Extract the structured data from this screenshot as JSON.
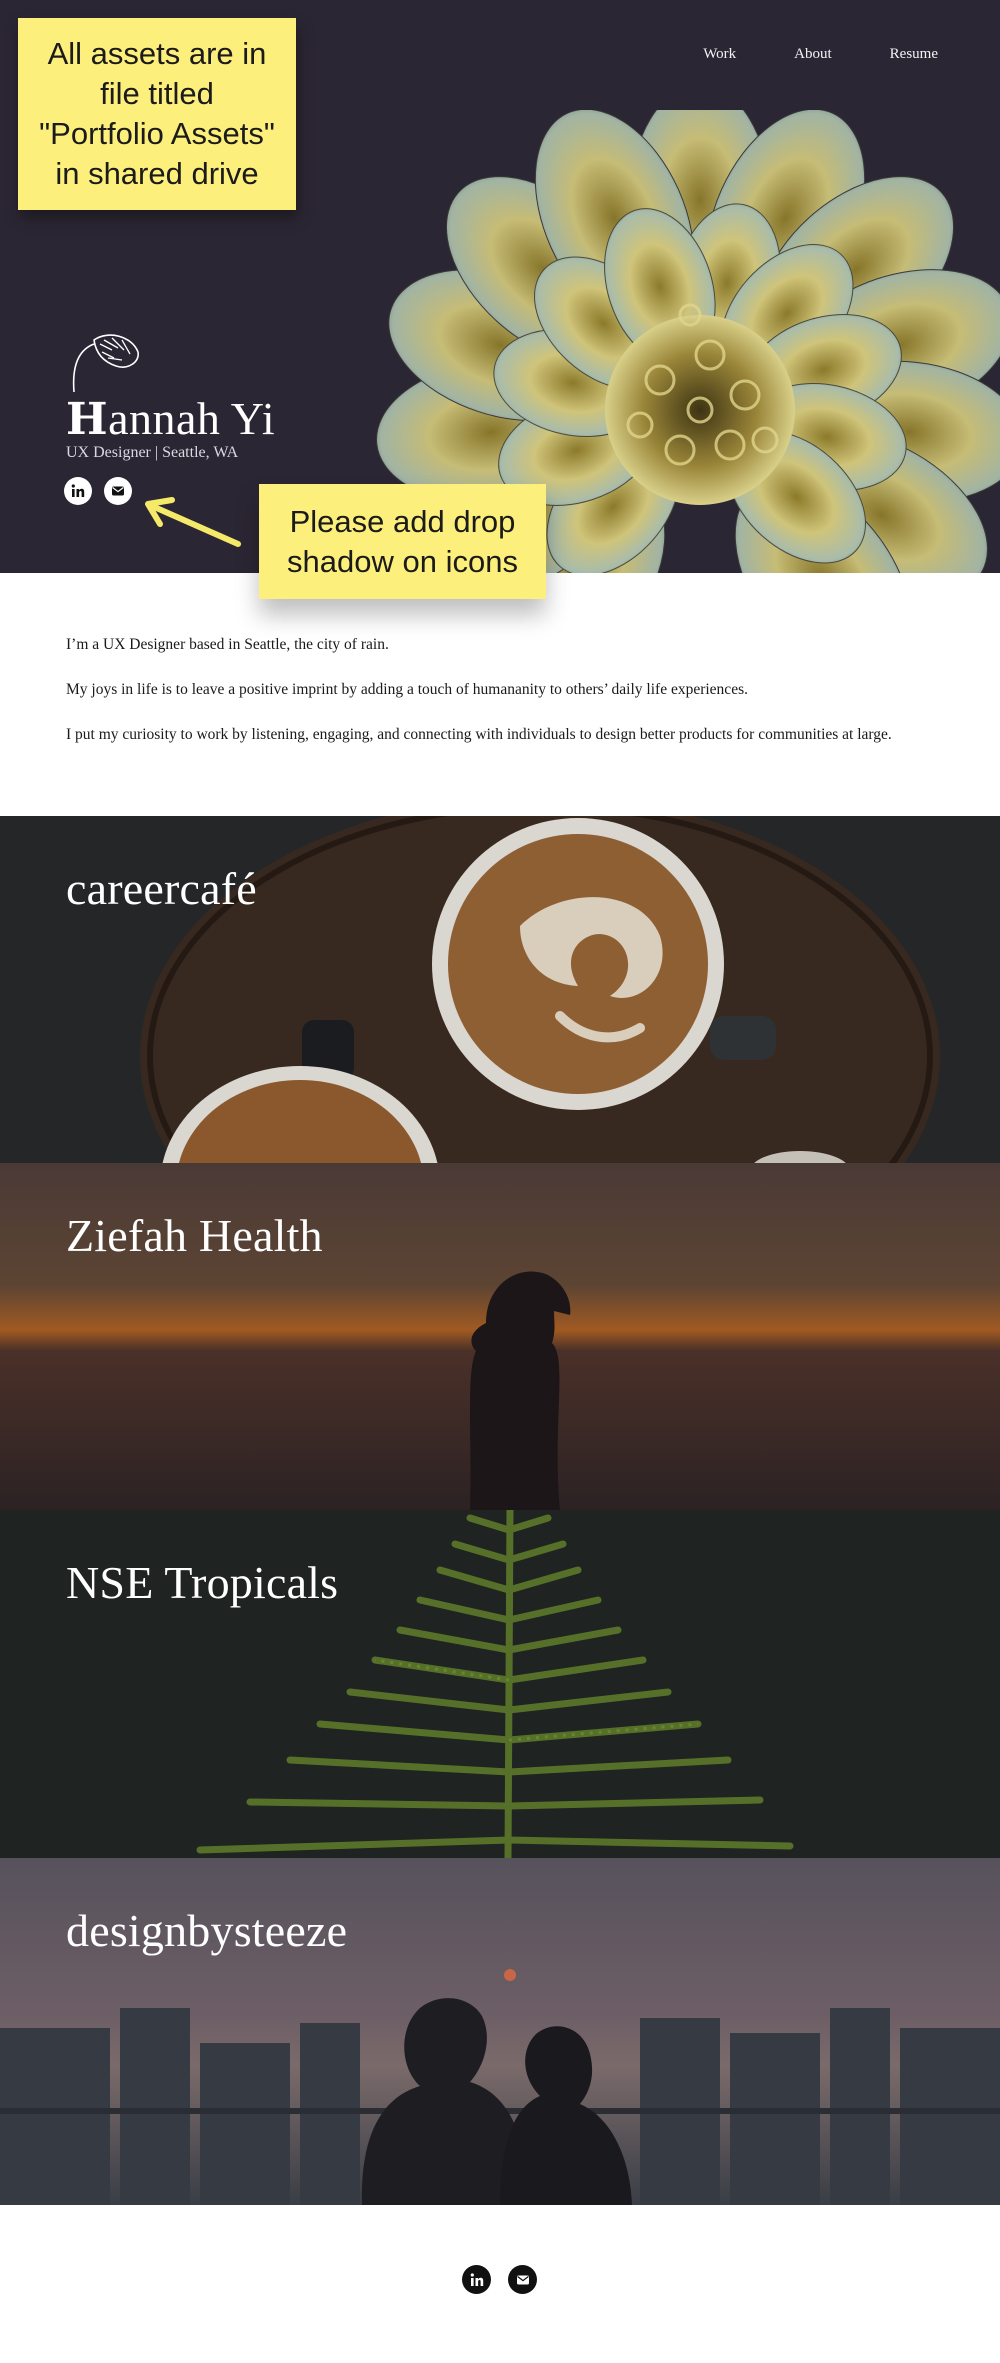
{
  "nav": {
    "items": [
      "Work",
      "About",
      "Resume"
    ]
  },
  "hero": {
    "name_cap": "H",
    "name_rest": "annah Yi",
    "subtitle": "UX Designer | Seattle, WA",
    "icons": [
      "linkedin-icon",
      "mail-icon"
    ]
  },
  "notes": {
    "assets_lines": [
      "All assets are in",
      "file titled",
      "\"Portfolio Assets\"",
      "in shared drive"
    ],
    "shadow_lines": [
      "Please add drop",
      "shadow on icons"
    ]
  },
  "intro": {
    "paragraphs": [
      "I’m a UX Designer based in Seattle, the city of rain.",
      "My joys in life is to leave a positive imprint by adding a touch of humananity to others’ daily life experiences.",
      "I put my curiosity to work by listening, engaging, and connecting with individuals to design better products for communities at large."
    ]
  },
  "projects": [
    {
      "title": "careercafé"
    },
    {
      "title": "Ziefah Health"
    },
    {
      "title": "NSE Tropicals"
    },
    {
      "title": "designbysteeze"
    }
  ],
  "footer": {
    "icons": [
      "linkedin-icon",
      "mail-icon"
    ]
  },
  "colors": {
    "hero_bg": "#2b2633",
    "note_yellow": "#fdef7c",
    "arrow_yellow": "#f5e96a"
  }
}
